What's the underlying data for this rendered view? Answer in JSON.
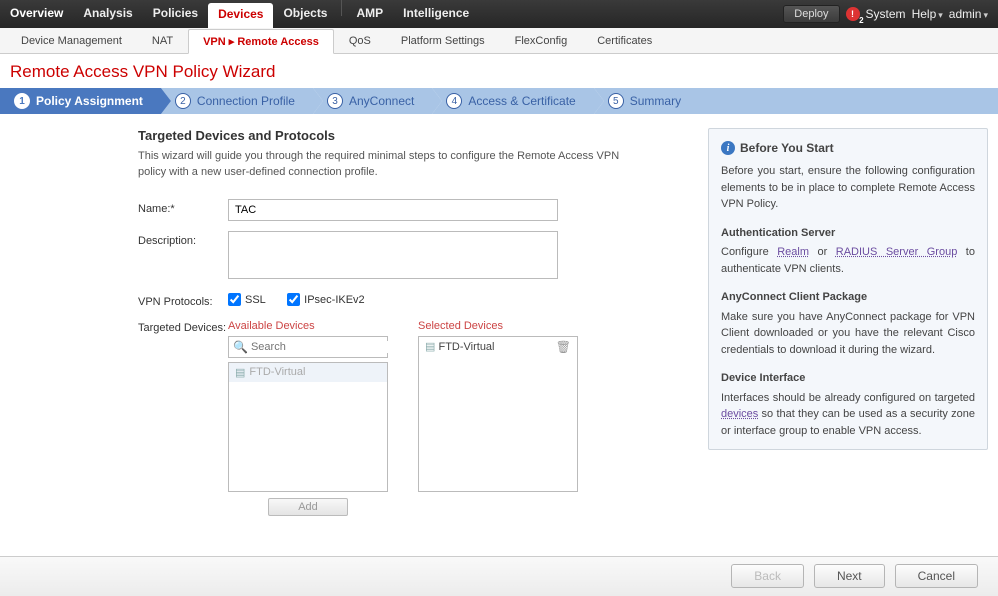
{
  "topnav": {
    "tabs": [
      "Overview",
      "Analysis",
      "Policies",
      "Devices",
      "Objects",
      "AMP",
      "Intelligence"
    ],
    "active_index": 3,
    "deploy": "Deploy",
    "alert_count": "2",
    "system": "System",
    "help": "Help",
    "user": "admin"
  },
  "subnav": {
    "tabs": [
      "Device Management",
      "NAT",
      "VPN ▸ Remote Access",
      "QoS",
      "Platform Settings",
      "FlexConfig",
      "Certificates"
    ],
    "active_index": 2
  },
  "page_title": "Remote Access VPN Policy Wizard",
  "steps": {
    "items": [
      "Policy Assignment",
      "Connection Profile",
      "AnyConnect",
      "Access & Certificate",
      "Summary"
    ],
    "active_index": 0
  },
  "form": {
    "section_title": "Targeted Devices and Protocols",
    "intro": "This wizard will guide you through the required minimal steps to configure the Remote Access VPN policy with a new user-defined connection profile.",
    "name_label": "Name:*",
    "name_value": "TAC",
    "desc_label": "Description:",
    "desc_value": "",
    "proto_label": "VPN Protocols:",
    "ssl_label": "SSL",
    "ipsec_label": "IPsec-IKEv2",
    "ssl_checked": true,
    "ipsec_checked": true,
    "targeted_label": "Targeted Devices:",
    "available_title": "Available Devices",
    "selected_title": "Selected Devices",
    "search_placeholder": "Search",
    "available_items": [
      "FTD-Virtual"
    ],
    "selected_items": [
      "FTD-Virtual"
    ],
    "add_btn": "Add"
  },
  "side": {
    "title": "Before You Start",
    "p1": "Before you start, ensure the following configuration elements to be in place to complete Remote Access VPN Policy.",
    "h_auth": "Authentication Server",
    "p_auth_pre": "Configure ",
    "p_auth_link1": "Realm",
    "p_auth_mid": " or ",
    "p_auth_link2": "RADIUS Server Group",
    "p_auth_post": " to authenticate VPN clients.",
    "h_any": "AnyConnect Client Package",
    "p_any": "Make sure you have AnyConnect package for VPN Client downloaded or you have the relevant Cisco credentials to download it during the wizard.",
    "h_dev": "Device Interface",
    "p_dev_pre": "Interfaces should be already configured on targeted ",
    "p_dev_link": "devices",
    "p_dev_post": " so that they can be used as a security zone or interface group to enable VPN access."
  },
  "footer": {
    "back": "Back",
    "next": "Next",
    "cancel": "Cancel"
  }
}
